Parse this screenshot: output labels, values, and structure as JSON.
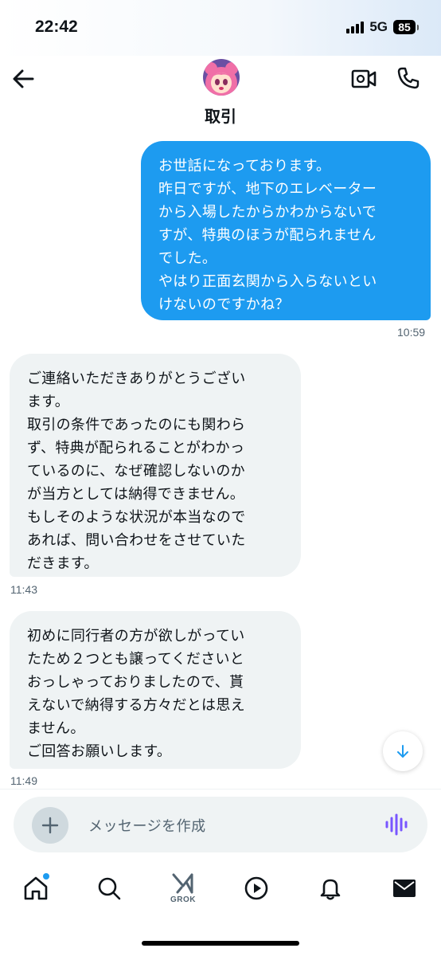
{
  "status": {
    "time": "22:42",
    "network": "5G",
    "battery": "85"
  },
  "header": {
    "contact_name": "取引",
    "icons": {
      "back": "arrow-left-icon",
      "video": "video-call-icon",
      "phone": "phone-icon"
    }
  },
  "messages": [
    {
      "direction": "sent",
      "text": "お世話になっております。\n昨日ですが、地下のエレベーター\nから入場したからかわからないで\nすが、特典のほうが配られません\nでした。\nやはり正面玄関から入らないとい\nけないのですかね？",
      "time": "10:59"
    },
    {
      "direction": "received",
      "text": "ご連絡いただきありがとうござい\nます。\n取引の条件であったのにも関わら\nず、特典が配られることがわかっ\nているのに、なぜ確認しないのか\nが当方としては納得できません。\nもしそのような状況が本当なので\nあれば、問い合わせをさせていた\nだきます。",
      "time": "11:43"
    },
    {
      "direction": "received",
      "text": "初めに同行者の方が欲しがってい\nたため２つとも譲ってくださいと\nおっしゃっておりましたので、貰\nえないで納得する方々だとは思え\nません。\nご回答お願いします。",
      "time": "11:49"
    }
  ],
  "composer": {
    "placeholder": "メッセージを作成"
  },
  "tabs": [
    {
      "name": "home",
      "icon": "home-icon",
      "notification_dot": true
    },
    {
      "name": "search",
      "icon": "search-icon"
    },
    {
      "name": "grok",
      "icon": "grok-icon",
      "label": "GROK"
    },
    {
      "name": "video",
      "icon": "play-icon"
    },
    {
      "name": "notifications",
      "icon": "bell-icon"
    },
    {
      "name": "messages",
      "icon": "mail-icon"
    }
  ],
  "colors": {
    "accent": "#1d9bf0",
    "received_bubble": "#eff3f4",
    "timestamp": "#536471",
    "voice_icon": "#7856ff"
  }
}
